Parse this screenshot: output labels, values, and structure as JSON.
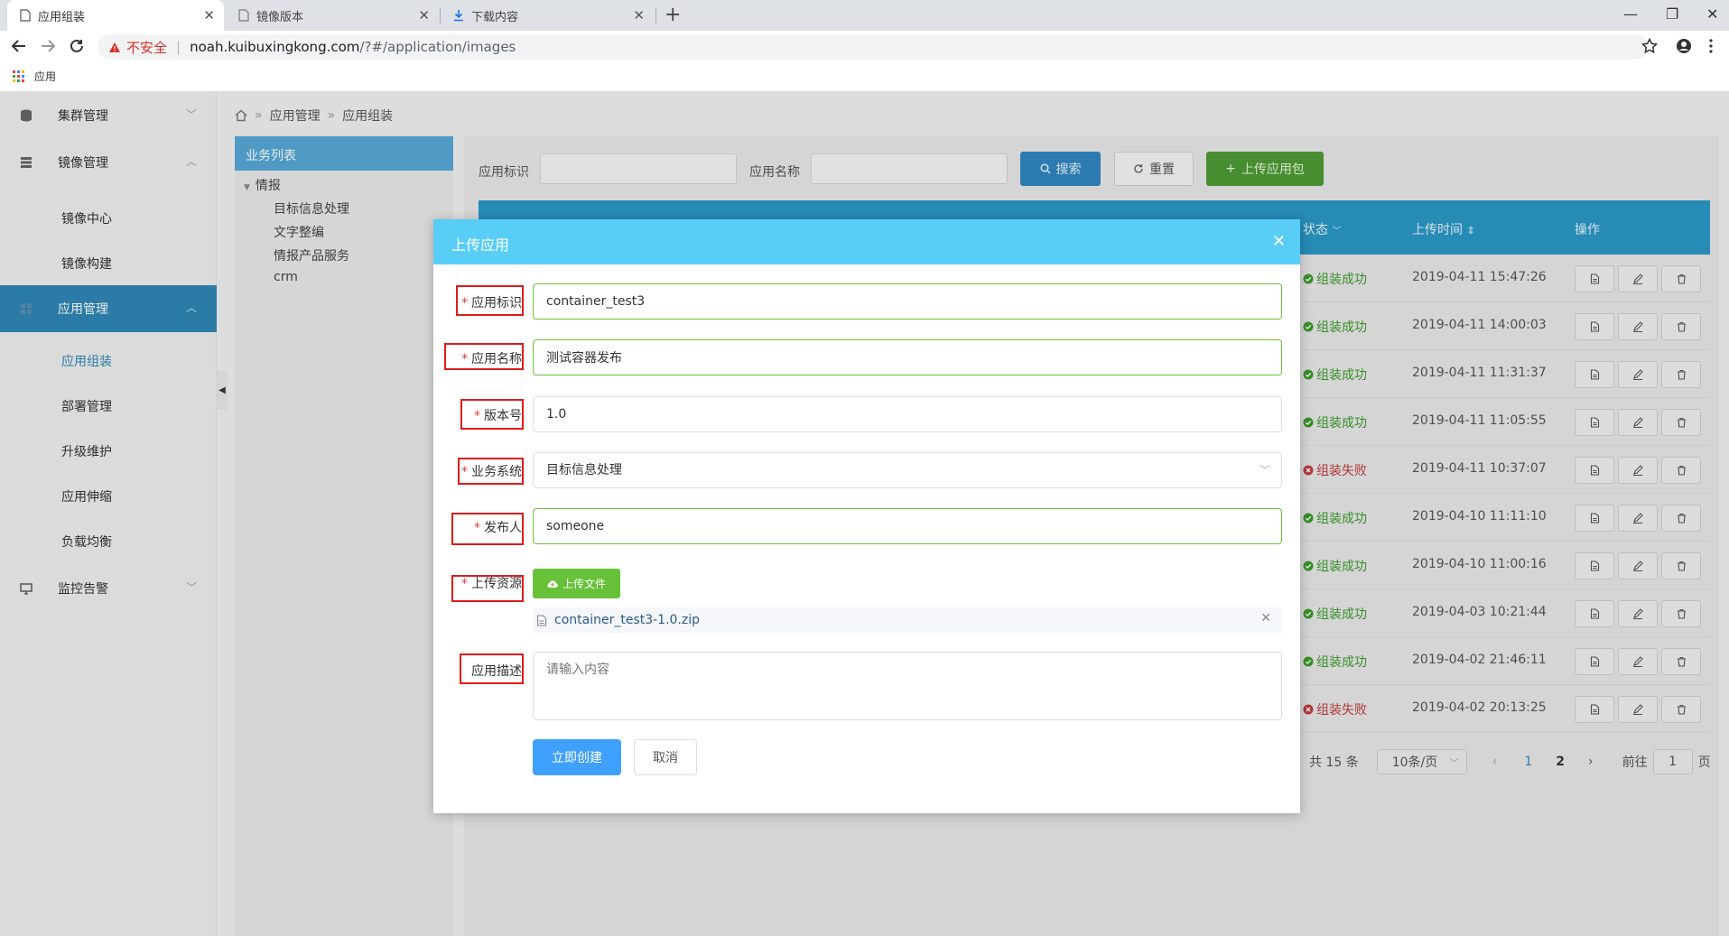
{
  "browser": {
    "tabs": [
      {
        "title": "应用组装",
        "active": true
      },
      {
        "title": "镜像版本",
        "active": false
      },
      {
        "title": "下载内容",
        "active": false
      }
    ],
    "security_warning": "不安全",
    "url_host": "noah.kuibuxingkong.com",
    "url_path": "/?#/application/images",
    "bookmark_apps": "应用"
  },
  "sidebar": {
    "groups": [
      {
        "label": "集群管理",
        "expanded": false
      },
      {
        "label": "镜像管理",
        "expanded": true,
        "items": [
          "镜像中心",
          "镜像构建"
        ]
      },
      {
        "label": "应用管理",
        "expanded": true,
        "active": true,
        "items": [
          "应用组装",
          "部署管理",
          "升级维护",
          "应用伸缩",
          "负载均衡"
        ],
        "active_item": "应用组装"
      },
      {
        "label": "监控告警",
        "expanded": false
      }
    ]
  },
  "breadcrumb": [
    "应用管理",
    "应用组装"
  ],
  "biz_list": {
    "title": "业务列表",
    "root": "情报",
    "children": [
      "目标信息处理",
      "文字整编",
      "情报产品服务"
    ],
    "other": "crm"
  },
  "filters": {
    "id_label": "应用标识",
    "name_label": "应用名称",
    "search_label": "搜索",
    "reset_label": "重置",
    "upload_label": "上传应用包"
  },
  "table": {
    "headers": {
      "status": "状态",
      "time": "上传时间",
      "ops": "操作"
    },
    "rows": [
      {
        "status": "组装成功",
        "ok": true,
        "time": "2019-04-11 15:47:26"
      },
      {
        "status": "组装成功",
        "ok": true,
        "time": "2019-04-11 14:00:03"
      },
      {
        "status": "组装成功",
        "ok": true,
        "time": "2019-04-11 11:31:37"
      },
      {
        "status": "组装成功",
        "ok": true,
        "time": "2019-04-11 11:05:55"
      },
      {
        "status": "组装失败",
        "ok": false,
        "time": "2019-04-11 10:37:07"
      },
      {
        "status": "组装成功",
        "ok": true,
        "time": "2019-04-10 11:11:10"
      },
      {
        "status": "组装成功",
        "ok": true,
        "time": "2019-04-10 11:00:16"
      },
      {
        "status": "组装成功",
        "ok": true,
        "time": "2019-04-03 10:21:44"
      },
      {
        "status": "组装成功",
        "ok": true,
        "time": "2019-04-02 21:46:11"
      },
      {
        "status": "组装失败",
        "ok": false,
        "time": "2019-04-02 20:13:25"
      }
    ]
  },
  "pager": {
    "total": "共 15 条",
    "page_size": "10条/页",
    "pages": [
      "1",
      "2"
    ],
    "current": "1",
    "goto_label": "前往",
    "goto_value": "1",
    "page_unit": "页"
  },
  "modal": {
    "title": "上传应用",
    "fields": {
      "app_id": {
        "label": "应用标识",
        "value": "container_test3"
      },
      "app_name": {
        "label": "应用名称",
        "value": "测试容器发布"
      },
      "version": {
        "label": "版本号",
        "value": "1.0"
      },
      "biz_system": {
        "label": "业务系统",
        "value": "目标信息处理"
      },
      "publisher": {
        "label": "发布人",
        "value": "someone"
      },
      "resource": {
        "label": "上传资源",
        "button": "上传文件",
        "file": "container_test3-1.0.zip"
      },
      "description": {
        "label": "应用描述",
        "placeholder": "请输入内容"
      }
    },
    "required_mark": "*",
    "submit_label": "立即创建",
    "cancel_label": "取消"
  }
}
